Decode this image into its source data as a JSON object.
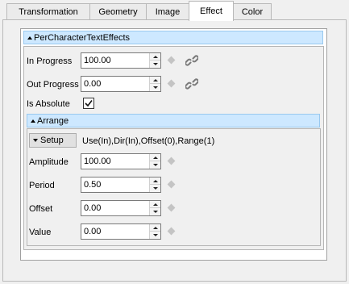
{
  "tabs": [
    {
      "label": "Transformation",
      "active": false
    },
    {
      "label": "Geometry",
      "active": false
    },
    {
      "label": "Image",
      "active": false
    },
    {
      "label": "Effect",
      "active": true
    },
    {
      "label": "Color",
      "active": false
    }
  ],
  "effect_section": {
    "title": "PerCharacterTextEffects",
    "in_progress": {
      "label": "In Progress",
      "value": "100.00"
    },
    "out_progress": {
      "label": "Out Progress",
      "value": "0.00"
    },
    "is_absolute": {
      "label": "Is Absolute",
      "checked": true
    }
  },
  "arrange_section": {
    "title": "Arrange",
    "setup_label": "Setup",
    "setup_summary": "Use(In),Dir(In),Offset(0),Range(1)",
    "amplitude": {
      "label": "Amplitude",
      "value": "100.00"
    },
    "period": {
      "label": "Period",
      "value": "0.50"
    },
    "offset": {
      "label": "Offset",
      "value": "0.00"
    },
    "value": {
      "label": "Value",
      "value": "0.00"
    }
  },
  "icons": {
    "link": "link-icon",
    "keyframe": "keyframe-diamond-icon"
  },
  "colors": {
    "section_header_bg": "#cde8ff",
    "section_header_border": "#99c9ef",
    "diamond": "#c4c4c4"
  }
}
